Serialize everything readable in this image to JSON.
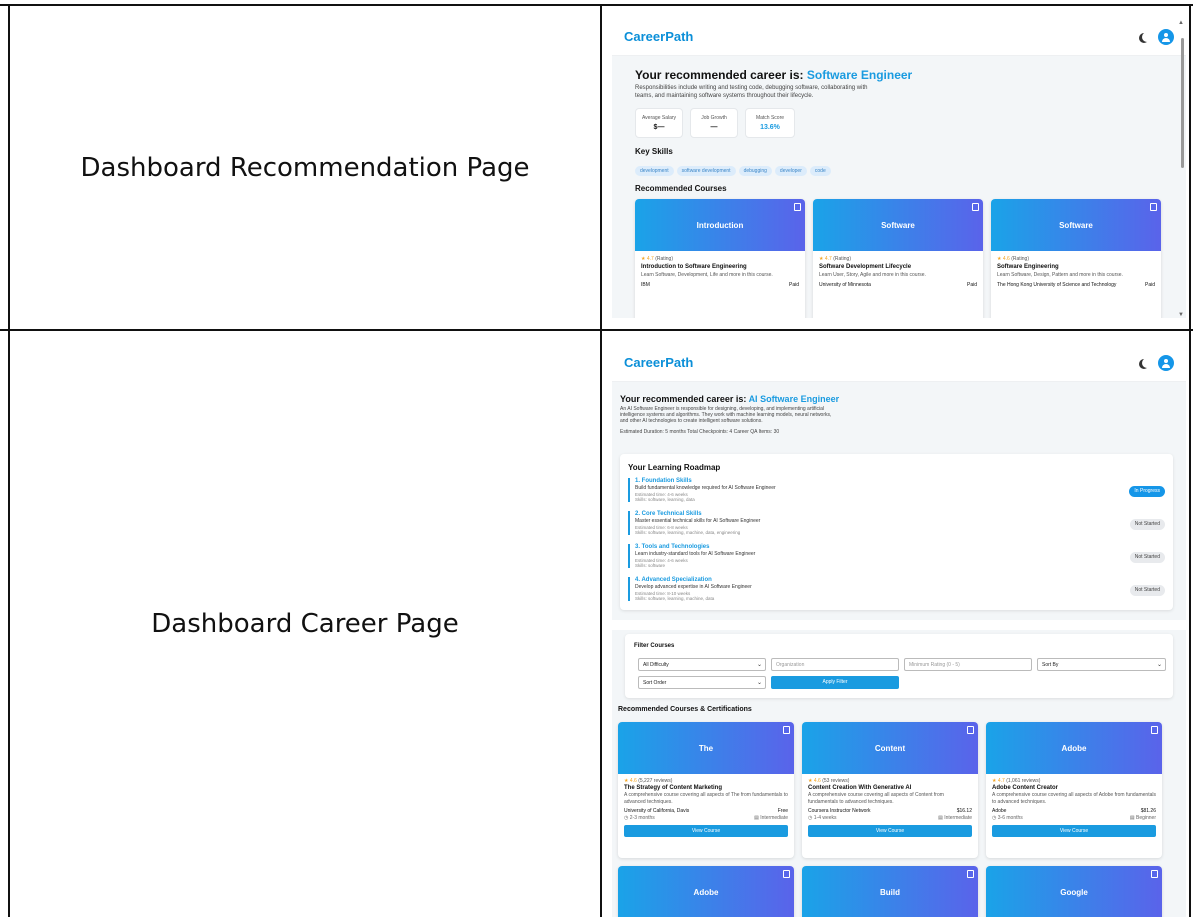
{
  "rows": [
    {
      "label": "Dashboard Recommendation Page"
    },
    {
      "label": "Dashboard Career Page"
    }
  ],
  "app": {
    "logo": "CareerPath"
  },
  "page1": {
    "heading_prefix": "Your recommended career is:",
    "career": "Software Engineer",
    "description": "Responsibilities include writing and testing code, debugging software, collaborating with teams, and maintaining software systems throughout their lifecycle.",
    "stats": [
      {
        "label": "Average Salary",
        "value": "$—"
      },
      {
        "label": "Job Growth",
        "value": "—"
      },
      {
        "label": "Match Score",
        "value": "13.6%"
      }
    ],
    "skills_title": "Key Skills",
    "skills": [
      "development",
      "software development",
      "debugging",
      "developer",
      "code"
    ],
    "courses_title": "Recommended Courses",
    "courses": [
      {
        "head": "Introduction",
        "rating": "4.7",
        "rating_note": "(Rating)",
        "title": "Introduction to Software Engineering",
        "desc": "Learn Software, Development, Life and more in this course.",
        "org": "IBM",
        "price": "Paid"
      },
      {
        "head": "Software",
        "rating": "4.7",
        "rating_note": "(Rating)",
        "title": "Software Development Lifecycle",
        "desc": "Learn User, Story, Agile and more in this course.",
        "org": "University of Minnesota",
        "price": "Paid"
      },
      {
        "head": "Software",
        "rating": "4.6",
        "rating_note": "(Rating)",
        "title": "Software Engineering",
        "desc": "Learn Software, Design, Pattern and more in this course.",
        "org": "The Hong Kong University of Science and Technology",
        "price": "Paid"
      }
    ]
  },
  "page2": {
    "heading_prefix": "Your recommended career is:",
    "career": "AI Software Engineer",
    "description": "An AI Software Engineer is responsible for designing, developing, and implementing artificial intelligence systems and algorithms. They work with machine learning models, neural networks, and other AI technologies to create intelligent software solutions.",
    "meta": "Estimated Duration: 5 months   Total Checkpoints: 4   Career QA Items: 30",
    "roadmap_title": "Your Learning Roadmap",
    "steps": [
      {
        "title": "1. Foundation Skills",
        "desc": "Build fundamental knowledge required for AI Software Engineer",
        "time": "Estimated time: 4-6 weeks",
        "skills": "Skills: software, learning, data",
        "status": "In Progress"
      },
      {
        "title": "2. Core Technical Skills",
        "desc": "Master essential technical skills for AI Software Engineer",
        "time": "Estimated time: 6-8 weeks",
        "skills": "Skills: software, learning, machine, data, engineering",
        "status": "Not Started"
      },
      {
        "title": "3. Tools and Technologies",
        "desc": "Learn industry-standard tools for AI Software Engineer",
        "time": "Estimated time: 4-6 weeks",
        "skills": "Skills: software",
        "status": "Not Started"
      },
      {
        "title": "4. Advanced Specialization",
        "desc": "Develop advanced expertise in AI Software Engineer",
        "time": "Estimated time: 8-10 weeks",
        "skills": "Skills: software, learning, machine, data",
        "status": "Not Started"
      }
    ],
    "filter": {
      "title": "Filter Courses",
      "difficulty": "All Difficulty",
      "org_placeholder": "Organization",
      "rating_placeholder": "Minimum Rating (0 - 5)",
      "sort_by": "Sort By",
      "sort_order": "Sort Order",
      "apply": "Apply Filter"
    },
    "courses_title": "Recommended Courses & Certifications",
    "courses": [
      {
        "head": "The",
        "rating": "4.6",
        "reviews": "(5,227 reviews)",
        "title": "The Strategy of Content Marketing",
        "desc": "A comprehensive course covering all aspects of The from fundamentals to advanced techniques.",
        "org": "University of California, Davis",
        "price": "Free",
        "duration": "2-3 months",
        "level": "Intermediate",
        "button": "View Course"
      },
      {
        "head": "Content",
        "rating": "4.6",
        "reviews": "(53 reviews)",
        "title": "Content Creation With Generative AI",
        "desc": "A comprehensive course covering all aspects of Content from fundamentals to advanced techniques.",
        "org": "Coursera Instructor Network",
        "price": "$16.12",
        "duration": "1-4 weeks",
        "level": "Intermediate",
        "button": "View Course"
      },
      {
        "head": "Adobe",
        "rating": "4.7",
        "reviews": "(1,061 reviews)",
        "title": "Adobe Content Creator",
        "desc": "A comprehensive course covering all aspects of Adobe from fundamentals to advanced techniques.",
        "org": "Adobe",
        "price": "$81.26",
        "duration": "3-6 months",
        "level": "Beginner",
        "button": "View Course"
      }
    ],
    "more_heads": [
      "Adobe",
      "Build",
      "Google"
    ]
  }
}
